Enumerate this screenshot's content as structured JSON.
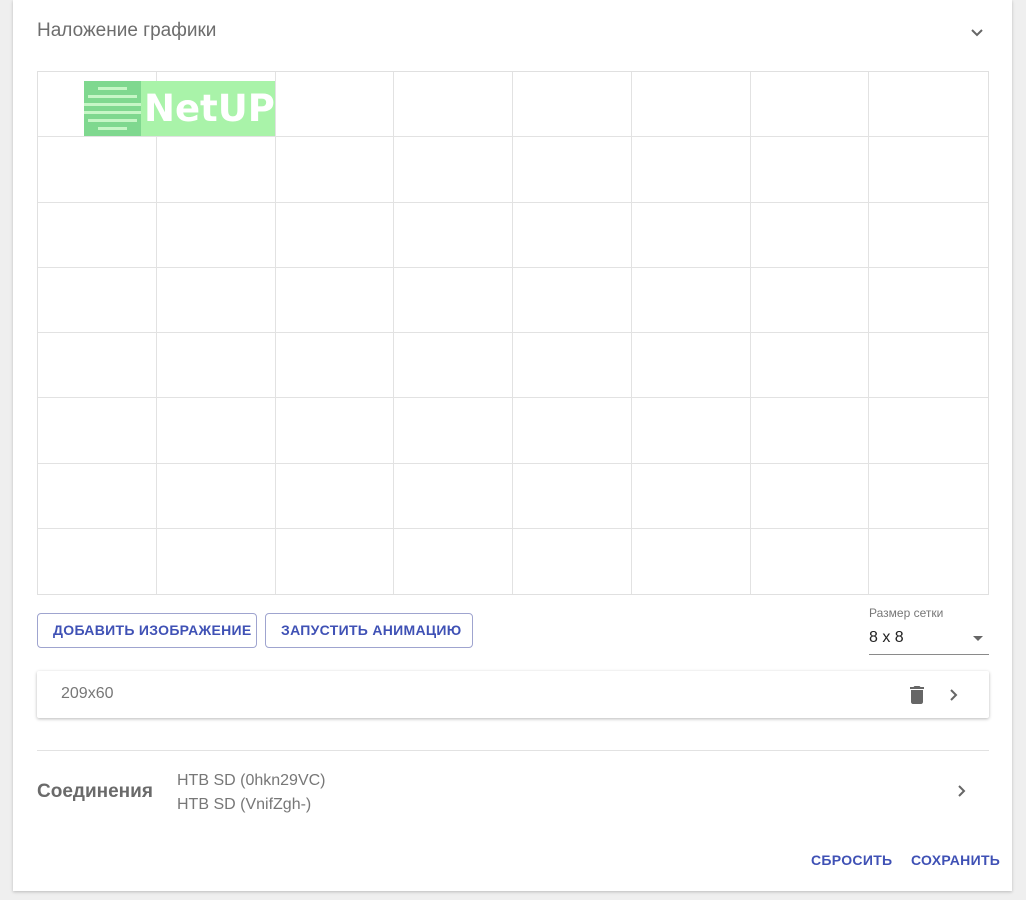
{
  "panel": {
    "title": "Наложение графики"
  },
  "grid": {
    "rows": 8,
    "columns": 8
  },
  "overlay_image": {
    "logo_text": "NetUP"
  },
  "actions": {
    "add_image_label": "ДОБАВИТЬ ИЗОБРАЖЕНИЕ",
    "start_animation_label": "ЗАПУСТИТЬ АНИМАЦИЮ"
  },
  "grid_size": {
    "label": "Размер сетки",
    "value": "8 x 8"
  },
  "images": [
    {
      "label": "209x60"
    }
  ],
  "connections": {
    "title": "Соединения",
    "items": [
      "HTB SD (0hkn29VC)",
      "HTB SD (VnifZgh-)"
    ]
  },
  "footer": {
    "reset_label": "СБРОСИТЬ",
    "save_label": "СОХРАНИТЬ"
  },
  "colors": {
    "accent": "#3f51b5",
    "overlay_fill": "#a9f3a9",
    "logo_mark": "#7fd88f",
    "icon": "#666666"
  },
  "icons": {
    "collapse": "chevron-up-icon",
    "delete": "delete-icon",
    "open_image": "chevron-right-icon",
    "open_connections": "chevron-right-icon",
    "dropdown": "dropdown-arrow-icon"
  }
}
